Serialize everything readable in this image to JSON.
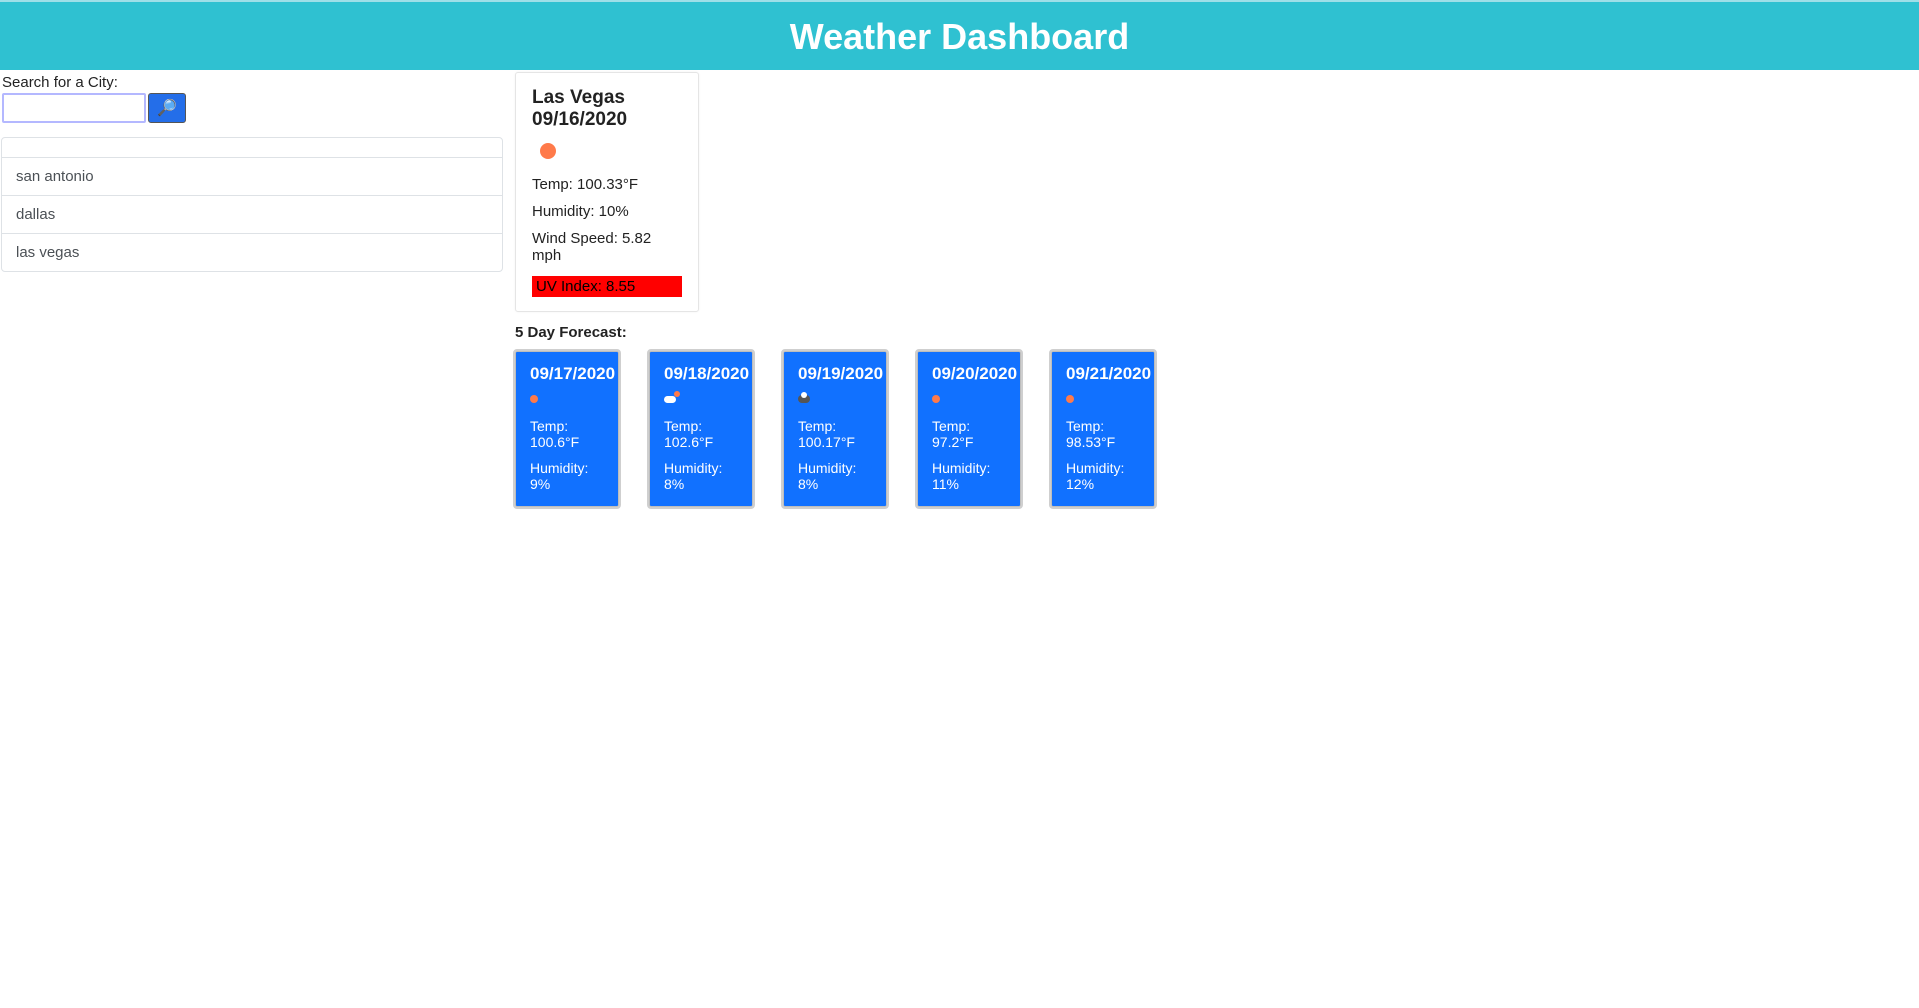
{
  "header": {
    "title": "Weather Dashboard"
  },
  "search": {
    "label": "Search for a City:",
    "input_value": "",
    "button_icon": "🔎"
  },
  "history": [
    "san antonio",
    "dallas",
    "las vegas"
  ],
  "current": {
    "title": "Las Vegas 09/16/2020",
    "icon": "sun",
    "temp_label": "Temp: 100.33°F",
    "humidity_label": "Humidity: 10%",
    "wind_label": "Wind Speed: 5.82 mph",
    "uv_label": "UV Index: 8.55",
    "uv_color": "#ff0000"
  },
  "forecast_title": "5 Day Forecast:",
  "forecast": [
    {
      "date": "09/17/2020",
      "icon": "sun",
      "temp": "Temp: 100.6°F",
      "humidity": "Humidity: 9%"
    },
    {
      "date": "09/18/2020",
      "icon": "cloud-sun",
      "temp": "Temp: 102.6°F",
      "humidity": "Humidity: 8%"
    },
    {
      "date": "09/19/2020",
      "icon": "cloud-dark",
      "temp": "Temp: 100.17°F",
      "humidity": "Humidity: 8%"
    },
    {
      "date": "09/20/2020",
      "icon": "sun",
      "temp": "Temp: 97.2°F",
      "humidity": "Humidity: 11%"
    },
    {
      "date": "09/21/2020",
      "icon": "sun",
      "temp": "Temp: 98.53°F",
      "humidity": "Humidity: 12%"
    }
  ]
}
